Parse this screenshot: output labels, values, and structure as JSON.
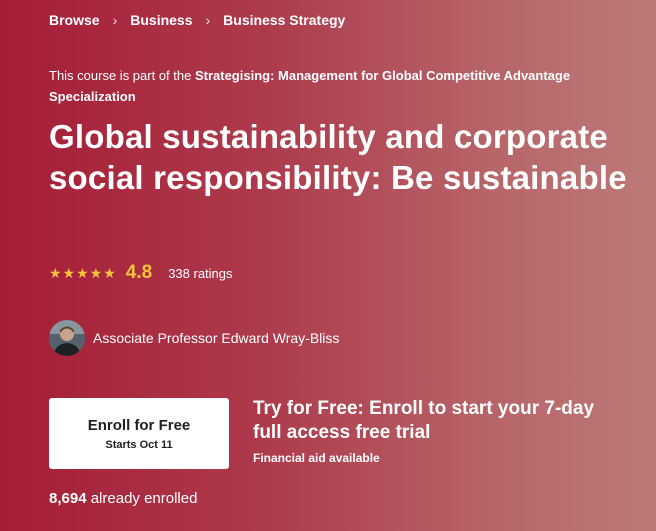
{
  "breadcrumb": [
    {
      "label": "Browse"
    },
    {
      "label": "Business"
    },
    {
      "label": "Business Strategy"
    }
  ],
  "spec_note": {
    "prefix": "This course is part of the ",
    "link": "Strategising: Management for Global Competitive Advantage Specialization"
  },
  "course": {
    "title": "Global sustainability and corporate social responsibility: Be sustainable",
    "rating": "4.8",
    "ratings_count": "338 ratings",
    "stars": "★★★★★"
  },
  "instructor": {
    "name": "Associate Professor Edward Wray-Bliss"
  },
  "enroll": {
    "label": "Enroll for Free",
    "date": "Starts Oct 11"
  },
  "trial": {
    "text": "Try for Free: Enroll to start your 7-day full access free trial",
    "aid": "Financial aid available"
  },
  "enrolled": {
    "count": "8,694",
    "suffix": " already enrolled"
  },
  "colors": {
    "accent_star": "#f7c23c",
    "bg_left": "#a51d36",
    "bg_right": "#bd7977"
  }
}
